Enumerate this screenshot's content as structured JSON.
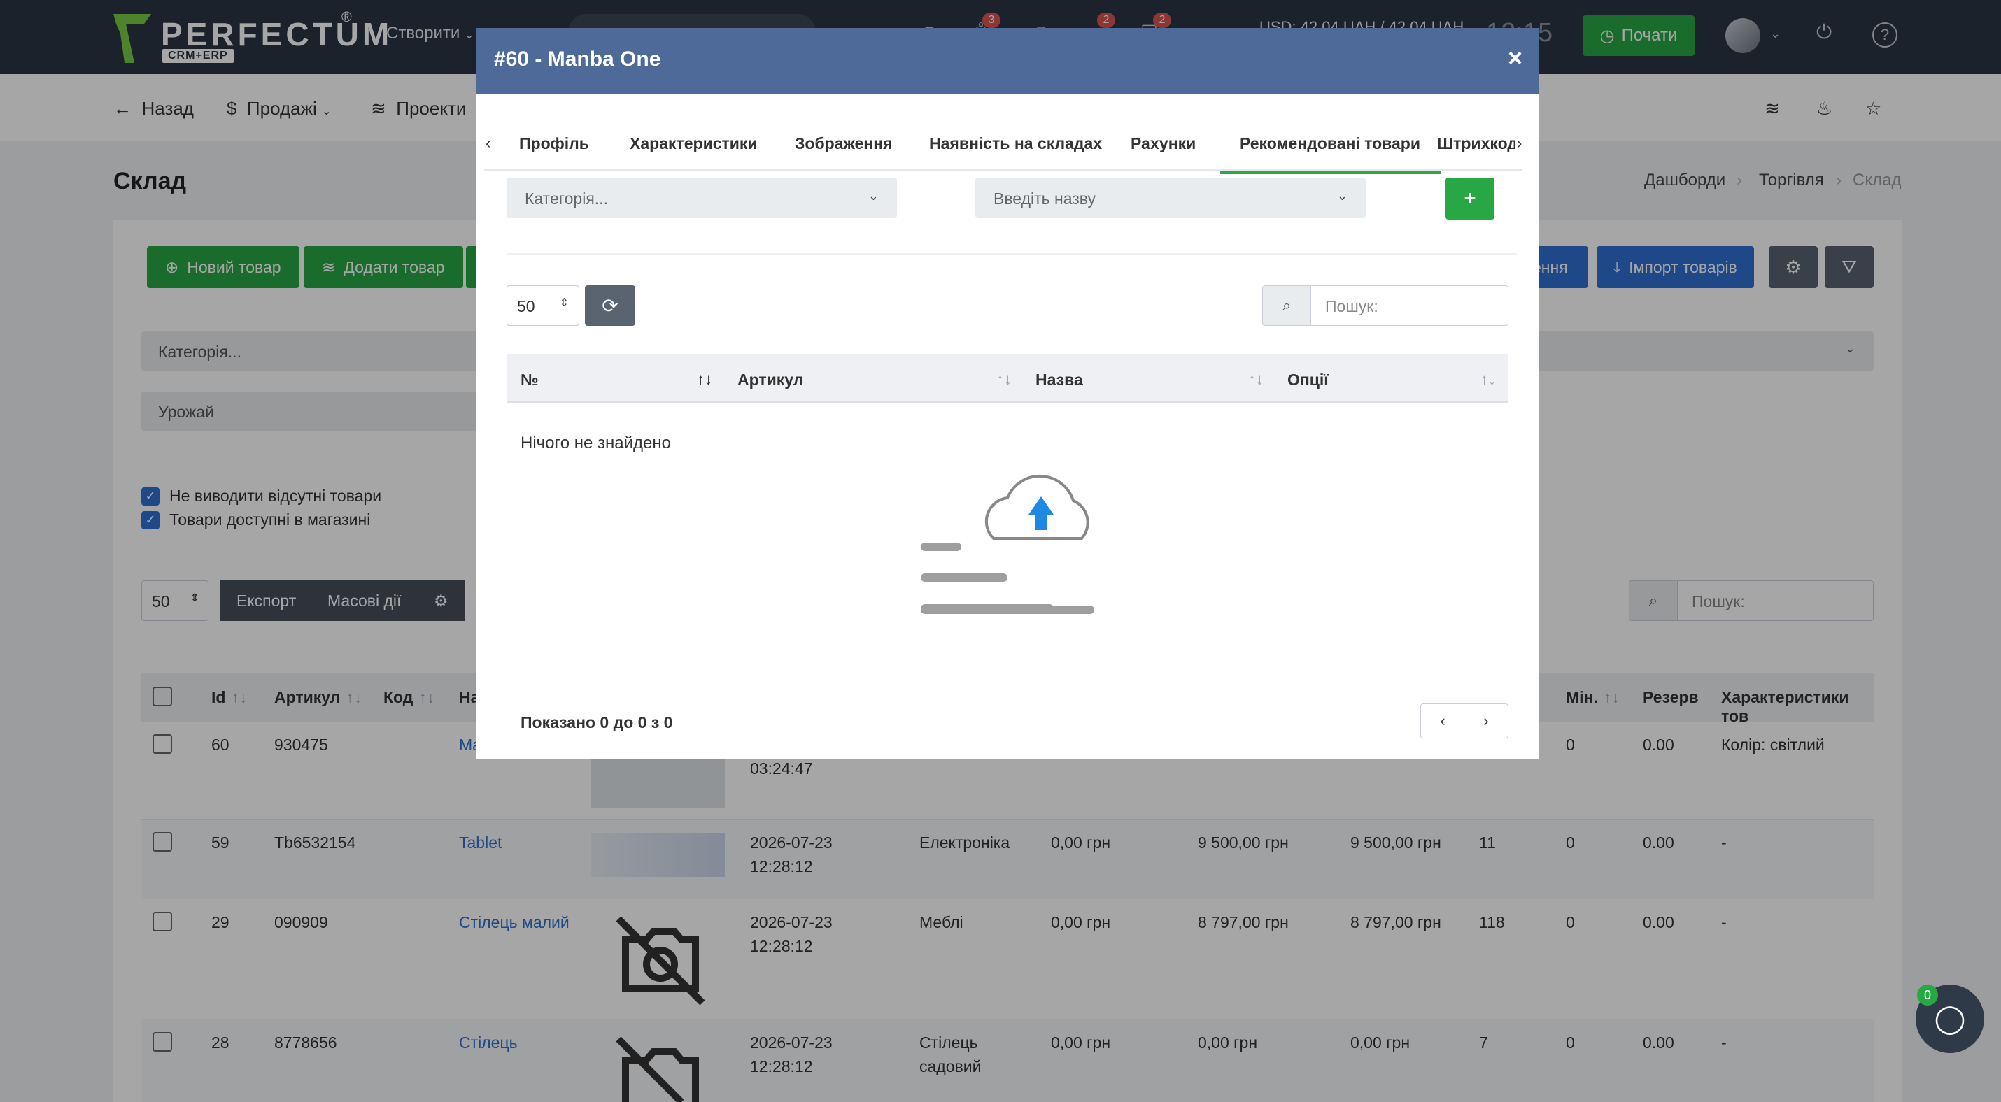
{
  "topbar": {
    "logo_text": "PERFECTUM",
    "logo_reg": "®",
    "logo_sub": "CRM+ERP",
    "create_label": "Створити",
    "badges": [
      "3",
      "2",
      "2"
    ],
    "rate_text": "USD: 42,04 UAH / 42,04 UAH",
    "clock_text": "12:15",
    "start_label": "Почати"
  },
  "subnav": {
    "back": "Назад",
    "sales": "Продажі",
    "projects": "Проекти"
  },
  "page": {
    "title": "Склад",
    "crumbs": [
      "Дашборди",
      "Торгівля",
      "Склад"
    ],
    "buttons": {
      "new_product": "Новий товар",
      "add_product": "Додати товар",
      "partial_right": "ення",
      "import": "Імпорт товарів"
    },
    "filters": {
      "category_placeholder": "Категорія...",
      "harvest_placeholder": "Урожай"
    },
    "checkboxes": [
      "Не виводити відсутні товари",
      "Товари доступні в магазині"
    ],
    "table_tools": {
      "page_len": "50",
      "export": "Експорт",
      "bulk": "Масові дії",
      "search_placeholder": "Пошук:"
    },
    "table": {
      "headers": [
        "Id",
        "Артикул",
        "Код",
        "На",
        "Мін.",
        "Резерв",
        "Характеристики тов"
      ],
      "rows": [
        {
          "id": "60",
          "sku": "930475",
          "name": "Ma",
          "date": "03:24:47",
          "category": "",
          "p1": "",
          "p2": "",
          "p3": "",
          "qty": "",
          "min": "0",
          "reserve": "0.00",
          "chars": "Колір: світлий"
        },
        {
          "id": "59",
          "sku": "Tb6532154",
          "name": "Tablet",
          "date": "2026-07-23\n12:28:12",
          "category": "Електроніка",
          "p1": "0,00 грн",
          "p2": "9 500,00 грн",
          "p3": "9 500,00 грн",
          "qty": "11",
          "min": "0",
          "reserve": "0.00",
          "chars": "-"
        },
        {
          "id": "29",
          "sku": "090909",
          "name": "Стілець малий",
          "date": "2026-07-23\n12:28:12",
          "category": "Меблі",
          "p1": "0,00 грн",
          "p2": "8 797,00 грн",
          "p3": "8 797,00 грн",
          "qty": "118",
          "min": "0",
          "reserve": "0.00",
          "chars": "-"
        },
        {
          "id": "28",
          "sku": "8778656",
          "name": "Стілець",
          "date": "2026-07-23\n12:28:12",
          "category": "Стілець\nсадовий",
          "p1": "0,00 грн",
          "p2": "0,00 грн",
          "p3": "0,00 грн",
          "qty": "7",
          "min": "0",
          "reserve": "0.00",
          "chars": "-"
        }
      ]
    }
  },
  "modal": {
    "title": "#60 - Manba One",
    "close": "×",
    "tabs": [
      "Профіль",
      "Характеристики",
      "Зображення",
      "Наявність на складах",
      "Рахунки",
      "Рекомендовані товари",
      "Штрихкоді"
    ],
    "active_tab": "Рекомендовані товари",
    "category_placeholder": "Категорія...",
    "name_placeholder": "Введіть назву",
    "add_label": "+",
    "page_len": "50",
    "search_placeholder": "Пошук:",
    "headers": [
      "№",
      "Артикул",
      "Назва",
      "Опції"
    ],
    "empty_text": "Нічого не знайдено",
    "info_text": "Показано 0 до 0 з 0"
  },
  "chat": {
    "badge": "0"
  },
  "colors": {
    "navbar": "#2b3542",
    "modal_header": "#4d6a99",
    "green": "#28a745",
    "blue": "#2f6fd1"
  }
}
